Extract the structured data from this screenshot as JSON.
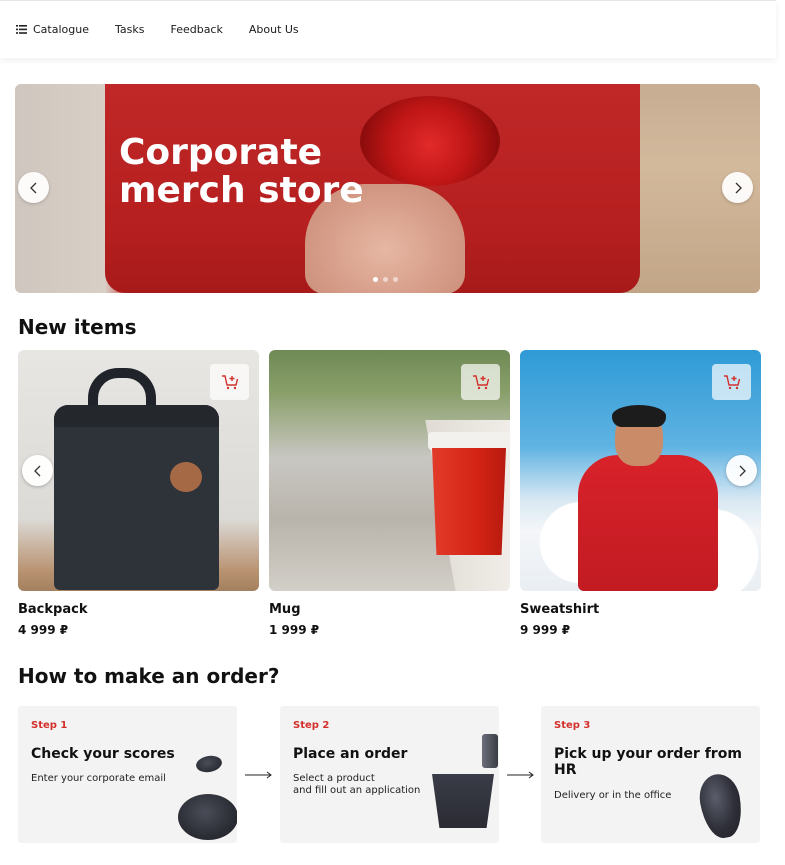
{
  "header": {
    "nav": [
      {
        "label": "Catalogue",
        "icon": "list-icon"
      },
      {
        "label": "Tasks"
      },
      {
        "label": "Feedback"
      },
      {
        "label": "About Us"
      }
    ]
  },
  "hero": {
    "title": "Corporate\nmerch store",
    "slides_count": 3,
    "active_slide": 1,
    "colors": {
      "shirt": "#c32323",
      "title": "#ffffff"
    }
  },
  "new_items": {
    "title": "New items",
    "products": [
      {
        "name": "Backpack",
        "price": "4 999 ₽",
        "icon": "add-to-cart-icon"
      },
      {
        "name": "Mug",
        "price": "1 999 ₽",
        "icon": "add-to-cart-icon"
      },
      {
        "name": "Sweatshirt",
        "price": "9 999 ₽",
        "icon": "add-to-cart-icon"
      }
    ]
  },
  "how_to_order": {
    "title": "How to make an order?",
    "steps": [
      {
        "label": "Step 1",
        "title": "Check your scores",
        "desc": "Enter your corporate email"
      },
      {
        "label": "Step 2",
        "title": "Place an order",
        "desc": "Select a product\nand fill out an application"
      },
      {
        "label": "Step 3",
        "title": "Pick up your order from HR",
        "desc": "Delivery or in the office"
      }
    ]
  },
  "colors": {
    "accent": "#d3302c",
    "step_bg": "#f4f3f3"
  }
}
